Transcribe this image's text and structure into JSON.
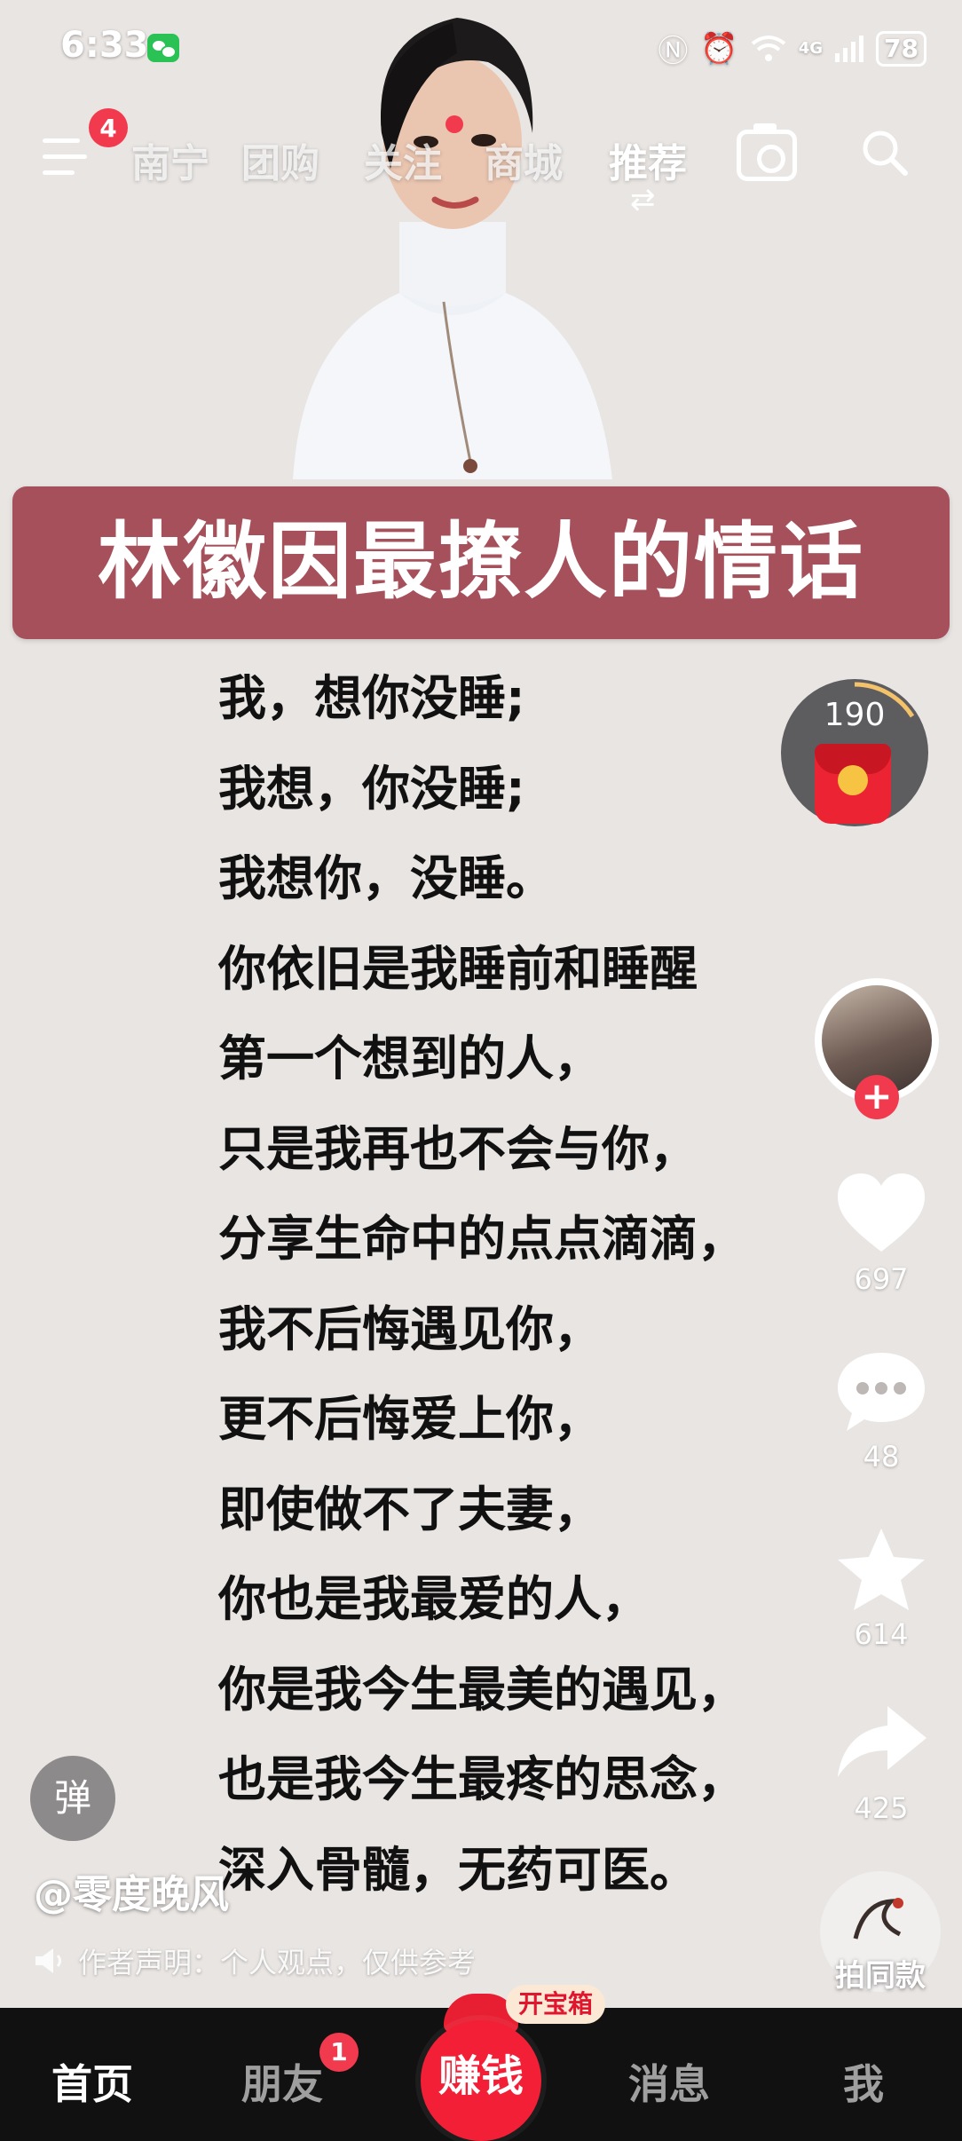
{
  "status_bar": {
    "time": "6:33",
    "network": "4G",
    "battery": "78"
  },
  "top_nav": {
    "menu_badge": "4",
    "tabs": [
      "南宁",
      "团购",
      "关注",
      "商城",
      "推荐"
    ],
    "active_tab": "推荐"
  },
  "video": {
    "title": "林徽因最撩人的情话",
    "poem_lines": [
      "我，想你没睡;",
      "我想，你没睡;",
      "我想你，没睡。",
      "你依旧是我睡前和睡醒",
      "第一个想到的人，",
      "只是我再也不会与你，",
      "分享生命中的点点滴滴，",
      "我不后悔遇见你，",
      "更不后悔爱上你，",
      "即使做不了夫妻，",
      "你也是我最爱的人，",
      "你是我今生最美的遇见，",
      "也是我今生最疼的思念，",
      "深入骨髓，无药可医。"
    ],
    "author": "@零度晚风",
    "declaration": "作者声明：个人观点，仅供参考",
    "danmu_label": "弹"
  },
  "side_actions": {
    "coin_count": "190",
    "likes": "697",
    "comments": "48",
    "favorites": "614",
    "shares": "425",
    "same_style_label": "拍同款"
  },
  "bottom_nav": {
    "home": "首页",
    "friends": "朋友",
    "friends_badge": "1",
    "earn": "赚钱",
    "treasure": "开宝箱",
    "messages": "消息",
    "me": "我"
  },
  "colors": {
    "accent_red": "#f23a4e",
    "banner": "#a5505a",
    "background": "#e9e5e3"
  }
}
